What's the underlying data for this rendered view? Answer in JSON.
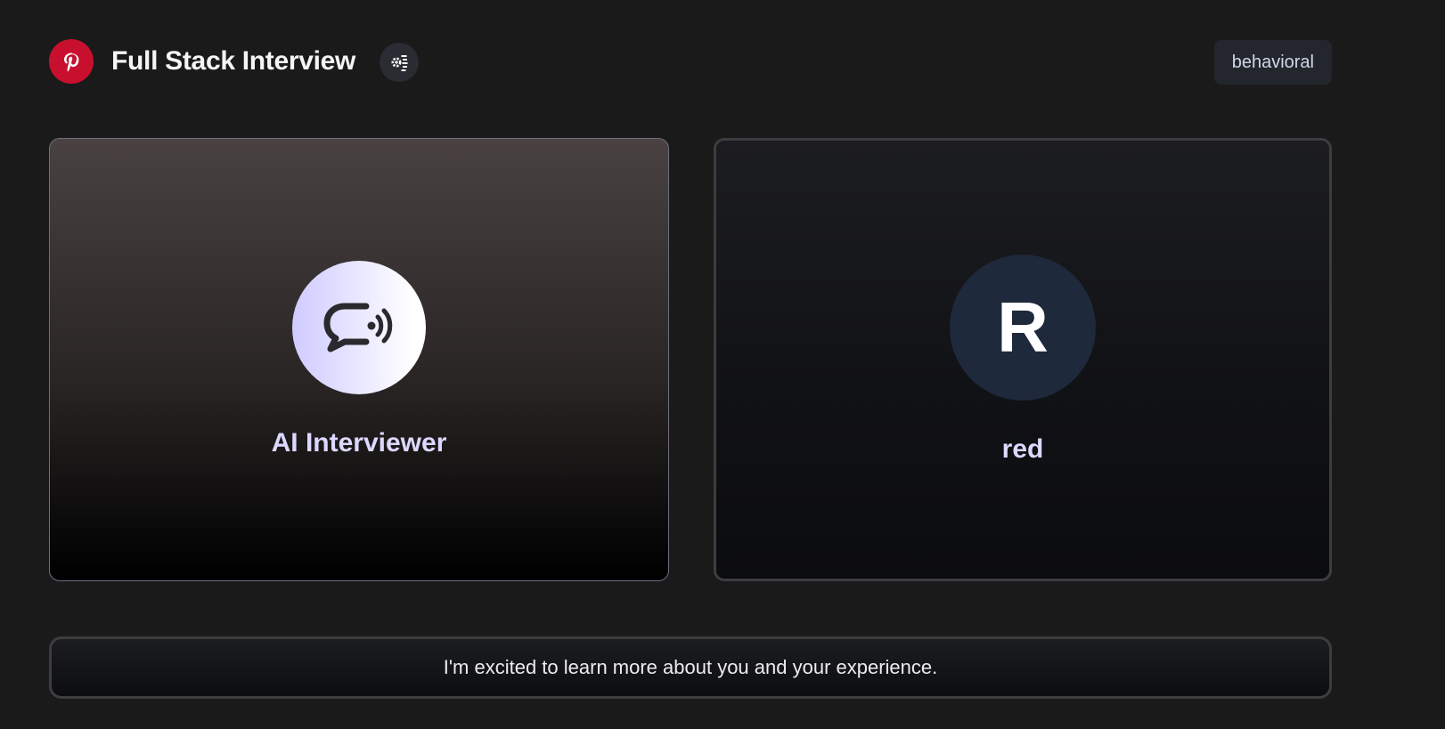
{
  "header": {
    "title": "Full Stack Interview",
    "company_logo_icon": "pinterest-logo-icon",
    "tech_icon": "gear-settings-icon",
    "interview_type": "behavioral"
  },
  "interviewer": {
    "name": "AI Interviewer",
    "avatar_icon": "speech-bubble-audio-icon"
  },
  "candidate": {
    "initial": "R",
    "name": "red"
  },
  "transcript": {
    "message": "I'm excited to learn more about you and your experience."
  },
  "colors": {
    "background": "#1a1a1a",
    "brand_red": "#c8102e",
    "name_lavender": "#dcd8ff",
    "candidate_avatar": "#1e293b"
  }
}
